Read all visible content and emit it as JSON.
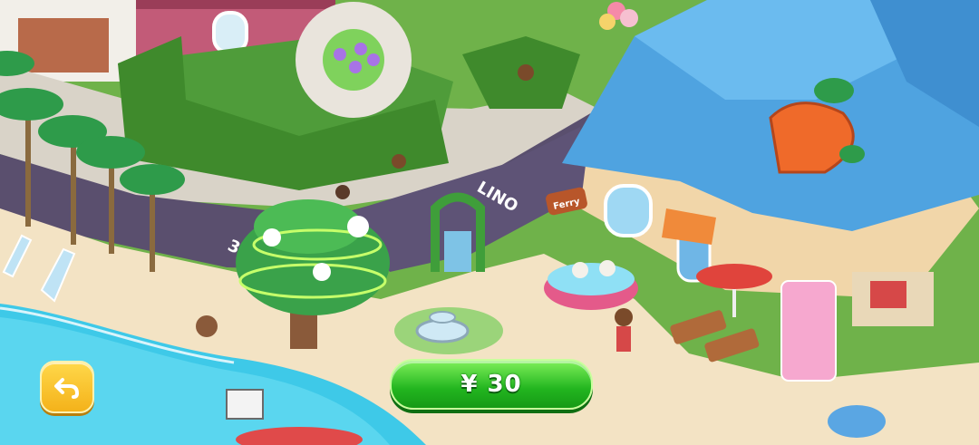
{
  "game": {
    "price_button": {
      "currency_symbol": "¥",
      "amount": "30",
      "label": "¥ 30"
    },
    "back_button": {
      "icon": "back-arrow-icon"
    },
    "signs": {
      "ferry": "Ferry",
      "road_speed": "30",
      "road_marking": "LINO"
    }
  },
  "colors": {
    "ocean": "#3ec9e8",
    "sand": "#f3e3c4",
    "road": "#5a4f6e",
    "lawn": "#6fb24a",
    "roof": "#4fa3e0",
    "price_button": "#22b51f",
    "back_button": "#f4b21a"
  }
}
